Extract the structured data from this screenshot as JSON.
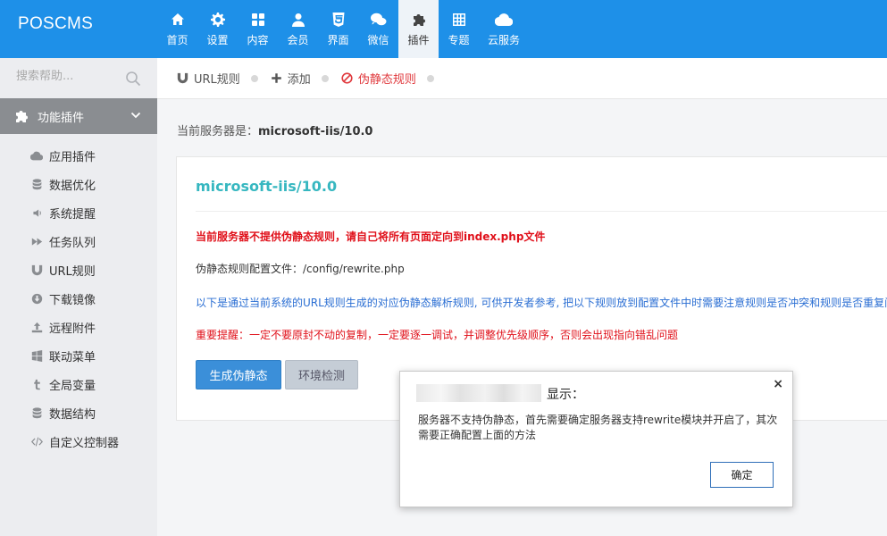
{
  "app": {
    "brand": "POSCMS"
  },
  "nav": [
    {
      "label": "首页",
      "icon": "home-icon"
    },
    {
      "label": "设置",
      "icon": "gear-icon"
    },
    {
      "label": "内容",
      "icon": "grid-icon"
    },
    {
      "label": "会员",
      "icon": "user-icon"
    },
    {
      "label": "界面",
      "icon": "html5-icon"
    },
    {
      "label": "微信",
      "icon": "wechat-icon"
    },
    {
      "label": "插件",
      "icon": "puzzle-icon",
      "active": true
    },
    {
      "label": "专题",
      "icon": "table-icon"
    },
    {
      "label": "云服务",
      "icon": "cloud-icon"
    }
  ],
  "sidebar": {
    "search_placeholder": "搜索帮助...",
    "group": "功能插件",
    "items": [
      {
        "label": "应用插件",
        "icon": "cloud-icon"
      },
      {
        "label": "数据优化",
        "icon": "database-icon"
      },
      {
        "label": "系统提醒",
        "icon": "volume-icon"
      },
      {
        "label": "任务队列",
        "icon": "forward-icon"
      },
      {
        "label": "URL规则",
        "icon": "magnet-icon"
      },
      {
        "label": "下载镜像",
        "icon": "download-icon"
      },
      {
        "label": "远程附件",
        "icon": "upload-icon"
      },
      {
        "label": "联动菜单",
        "icon": "windows-icon"
      },
      {
        "label": "全局变量",
        "icon": "tumblr-icon"
      },
      {
        "label": "数据结构",
        "icon": "database-icon"
      },
      {
        "label": "自定义控制器",
        "icon": "code-icon"
      }
    ]
  },
  "breadcrumb": {
    "url_rules": "URL规则",
    "add": "添加",
    "rewrite": "伪静态规则"
  },
  "main": {
    "server_label": "当前服务器是：",
    "server_value": "microsoft-iis/10.0",
    "card_title": "microsoft-iis/10.0",
    "warning": "当前服务器不提供伪静态规则，请自己将所有页面定向到index.php文件",
    "config_file": "伪静态规则配置文件：/config/rewrite.php",
    "info": "以下是通过当前系统的URL规则生成的对应伪静态解析规则, 可供开发者参考, 把以下规则放到配置文件中时需要注意规则是否冲突和规则是否重复问题",
    "notice": "重要提醒：一定不要原封不动的复制，一定要逐一调试，并调整优先级顺序，否则会出现指向错乱问题",
    "btn_generate": "生成伪静态",
    "btn_env": "环境检测"
  },
  "dialog": {
    "title": "显示：",
    "message": "服务器不支持伪静态，首先需要确定服务器支持rewrite模块并开启了，其次需要正确配置上面的方法",
    "ok": "确定",
    "close": "×"
  },
  "colors": {
    "topbar": "#1e90e8",
    "accent": "#36b7c0",
    "danger": "#e0101a",
    "link": "#2a6ed3",
    "primary_btn": "#3b8fd9"
  }
}
